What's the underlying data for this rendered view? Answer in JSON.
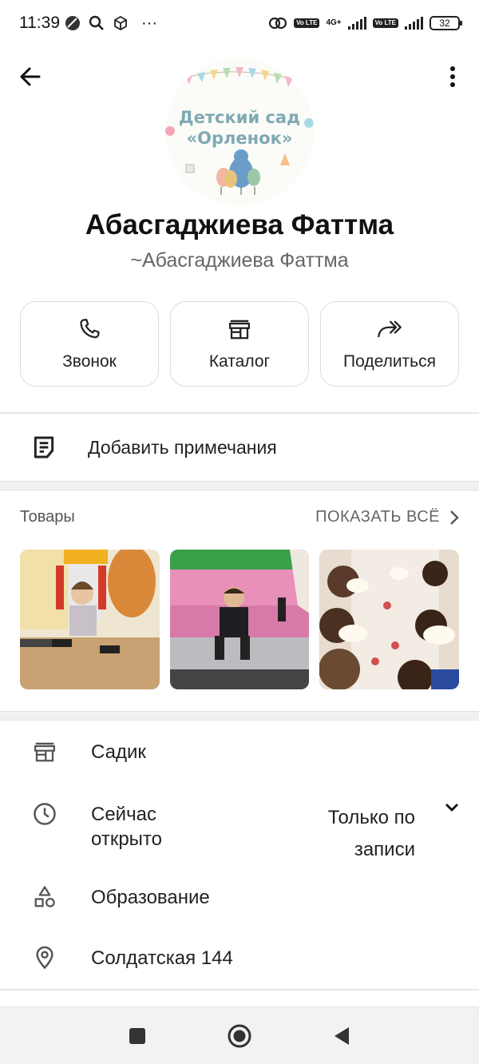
{
  "status_bar": {
    "time": "11:39",
    "more": "···",
    "volte1": "Vo LTE",
    "net": "4G+",
    "volte2": "Vo LTE",
    "battery": "32"
  },
  "header": {
    "back_icon": "arrow-left-icon",
    "menu_icon": "more-vertical-icon"
  },
  "profile": {
    "avatar_line1": "Детский сад",
    "avatar_line2": "«Орленок»",
    "name": "Абасгаджиева Фаттма",
    "subtitle": "~Абасгаджиева Фаттма"
  },
  "actions": [
    {
      "label": "Звонок",
      "icon": "phone-icon"
    },
    {
      "label": "Каталог",
      "icon": "store-icon"
    },
    {
      "label": "Поделиться",
      "icon": "share-icon"
    }
  ],
  "notes": {
    "label": "Добавить примечания",
    "icon": "note-icon"
  },
  "products": {
    "title": "Товары",
    "show_all": "ПОКАЗАТЬ ВСЁ",
    "items": [
      "product-photo-1",
      "product-photo-2",
      "product-photo-3"
    ]
  },
  "info": {
    "category": "Садик",
    "status_line1": "Сейчас",
    "status_line2": "открыто",
    "hours_line1": "Только по",
    "hours_line2": "записи",
    "business_type": "Образование",
    "address": "Солдатская 144"
  },
  "colors": {
    "accent_green": "#1a9e4a",
    "link_blue": "#1a73c8"
  }
}
